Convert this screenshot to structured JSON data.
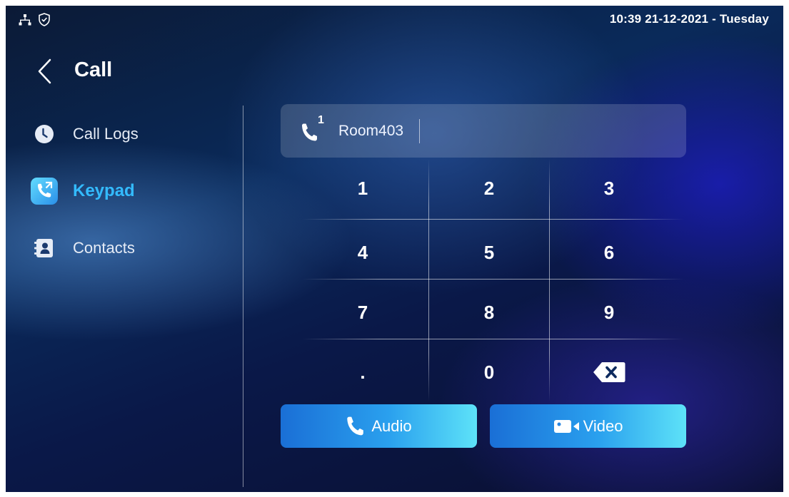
{
  "status_bar": {
    "datetime": "10:39  21-12-2021 - Tuesday",
    "icons": [
      "network-icon",
      "shield-check-icon"
    ]
  },
  "header": {
    "title": "Call",
    "back_icon": "chevron-left-icon"
  },
  "sidebar": {
    "items": [
      {
        "label": "Call Logs",
        "icon": "clock-icon",
        "active": false
      },
      {
        "label": "Keypad",
        "icon": "phone-keypad-icon",
        "active": true
      },
      {
        "label": "Contacts",
        "icon": "contacts-book-icon",
        "active": false
      }
    ]
  },
  "dial_input": {
    "line_number": "1",
    "value": "Room403",
    "icon": "phone-icon"
  },
  "keypad": {
    "keys": [
      "1",
      "2",
      "3",
      "4",
      "5",
      "6",
      "7",
      "8",
      "9",
      ".",
      "0",
      "⌫"
    ],
    "backspace_icon": "backspace-icon"
  },
  "actions": {
    "audio_label": "Audio",
    "video_label": "Video",
    "audio_icon": "phone-icon",
    "video_icon": "video-camera-icon"
  },
  "colors": {
    "accent": "#33bbff",
    "button_gradient_start": "#1a6fd6",
    "button_gradient_end": "#5de2f8"
  }
}
